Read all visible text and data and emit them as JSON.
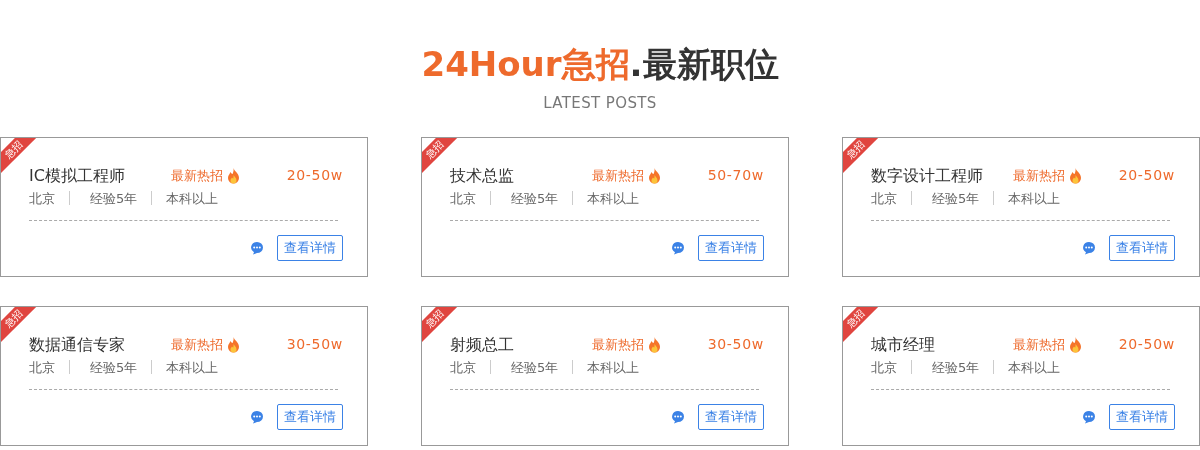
{
  "header": {
    "title_highlight": "24Hour急招",
    "title_rest": ".最新职位",
    "subtitle": "LATEST POSTS"
  },
  "jobs": [
    {
      "ribbon": "急招",
      "title": "IC模拟工程师",
      "hot": "最新热招",
      "salary": "20-50w",
      "meta": [
        "北京",
        "经验5年",
        "本科以上"
      ],
      "button": "查看详情"
    },
    {
      "ribbon": "急招",
      "title": "技术总监",
      "hot": "最新热招",
      "salary": "50-70w",
      "meta": [
        "北京",
        "经验5年",
        "本科以上"
      ],
      "button": "查看详情"
    },
    {
      "ribbon": "急招",
      "title": "数字设计工程师",
      "hot": "最新热招",
      "salary": "20-50w",
      "meta": [
        "北京",
        "经验5年",
        "本科以上"
      ],
      "button": "查看详情"
    },
    {
      "ribbon": "急招",
      "title": "数据通信专家",
      "hot": "最新热招",
      "salary": "30-50w",
      "meta": [
        "北京",
        "经验5年",
        "本科以上"
      ],
      "button": "查看详情"
    },
    {
      "ribbon": "急招",
      "title": "射频总工",
      "hot": "最新热招",
      "salary": "30-50w",
      "meta": [
        "北京",
        "经验5年",
        "本科以上"
      ],
      "button": "查看详情"
    },
    {
      "ribbon": "急招",
      "title": "城市经理",
      "hot": "最新热招",
      "salary": "20-50w",
      "meta": [
        "北京",
        "经验5年",
        "本科以上"
      ],
      "button": "查看详情"
    }
  ]
}
